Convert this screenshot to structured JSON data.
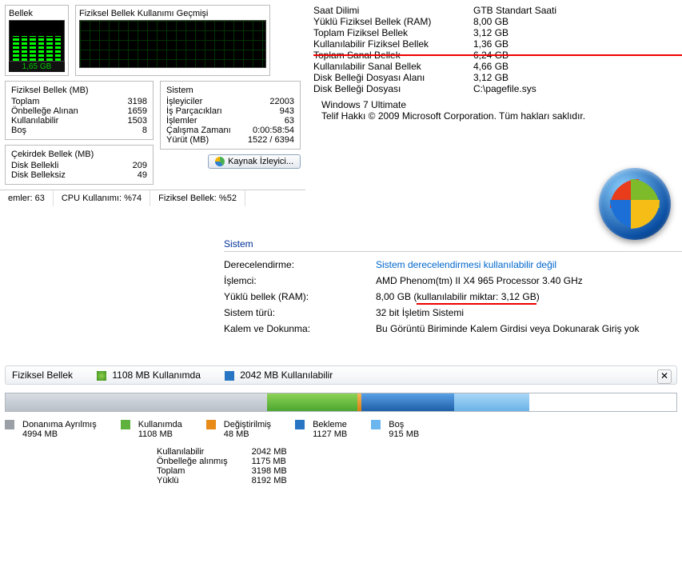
{
  "taskmgr": {
    "mem_panel_title": "Bellek",
    "hist_panel_title": "Fiziksel Bellek Kullanımı Geçmişi",
    "mem_gauge_value": "1,65 GB",
    "pm": {
      "title": "Fiziksel Bellek (MB)",
      "r1k": "Toplam",
      "r1v": "3198",
      "r2k": "Önbelleğe Alınan",
      "r2v": "1659",
      "r3k": "Kullanılabilir",
      "r3v": "1503",
      "r4k": "Boş",
      "r4v": "8"
    },
    "km": {
      "title": "Çekirdek Bellek (MB)",
      "r1k": "Disk Bellekli",
      "r1v": "209",
      "r2k": "Disk Belleksiz",
      "r2v": "49"
    },
    "sy": {
      "title": "Sistem",
      "r1k": "İşleyiciler",
      "r1v": "22003",
      "r2k": "İş Parçacıkları",
      "r2v": "943",
      "r3k": "İşlemler",
      "r3v": "63",
      "r4k": "Çalışma Zamanı",
      "r4v": "0:00:58:54",
      "r5k": "Yürüt (MB)",
      "r5v": "1522 / 6394"
    },
    "button": "Kaynak İzleyici...",
    "status1": "emler: 63",
    "status2": "CPU Kullanımı: %74",
    "status3": "Fiziksel Bellek: %52"
  },
  "sysinfo": {
    "r1k": "Saat Dilimi",
    "r1v": "GTB Standart Saati",
    "r2k": "Yüklü Fiziksel Bellek (RAM)",
    "r2v": "8,00 GB",
    "r3k": "Toplam Fiziksel Bellek",
    "r3v": "3,12 GB",
    "r4k": "Kullanılabilir Fiziksel Bellek",
    "r4v": "1,36 GB",
    "r5k": "Toplam Sanal Bellek",
    "r5v": "6,24 GB",
    "r6k": "Kullanılabilir Sanal Bellek",
    "r6v": "4,66 GB",
    "r7k": "Disk Belleği Dosyası Alanı",
    "r7v": "3,12 GB",
    "r8k": "Disk Belleği Dosyası",
    "r8v": "C:\\pagefile.sys",
    "winver": "Windows 7 Ultimate",
    "copy": "Telif Hakkı © 2009 Microsoft Corporation. Tüm hakları saklıdır."
  },
  "props": {
    "head": "Sistem",
    "r1k": "Derecelendirme:",
    "r1v": "Sistem derecelendirmesi kullanılabilir değil",
    "r2k": "İşlemci:",
    "r2v": "AMD Phenom(tm) II X4 965 Processor   3.40 GHz",
    "r3k": "Yüklü bellek (RAM):",
    "r3va": "8,00 GB (",
    "r3vb": "kullanılabilir miktar: 3,12 GB",
    "r3vc": ")",
    "r4k": "Sistem türü:",
    "r4v": "32 bit İşletim Sistemi",
    "r5k": "Kalem ve Dokunma:",
    "r5v": "Bu Görüntü Biriminde Kalem Girdisi veya Dokunarak Giriş yok"
  },
  "resmon": {
    "title": "Fiziksel Bellek",
    "used_label": "1108 MB Kullanımda",
    "avail_label": "2042 MB Kullanılabilir",
    "leg1t": "Donanıma Ayrılmış",
    "leg1v": "4994 MB",
    "leg2t": "Kullanımda",
    "leg2v": "1108 MB",
    "leg3t": "Değiştirilmiş",
    "leg3v": "48 MB",
    "leg4t": "Bekleme",
    "leg4v": "1127 MB",
    "leg5t": "Boş",
    "leg5v": "915 MB",
    "e1k": "Kullanılabilir",
    "e1v": "2042 MB",
    "e2k": "Önbelleğe alınmış",
    "e2v": "1175 MB",
    "e3k": "Toplam",
    "e3v": "3198 MB",
    "e4k": "Yüklü",
    "e4v": "8192 MB"
  }
}
